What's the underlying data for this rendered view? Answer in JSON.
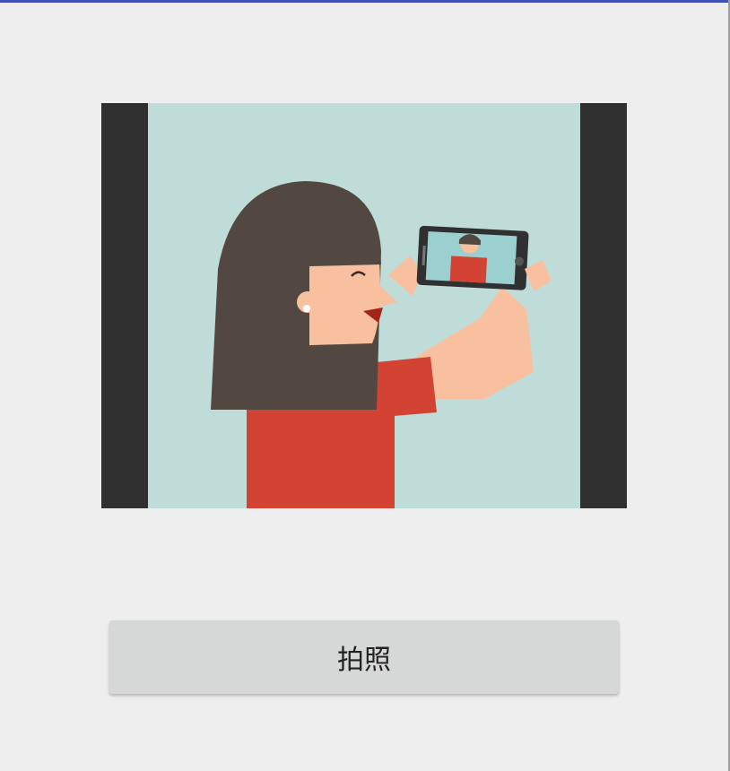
{
  "capture": {
    "button_label": "拍照"
  },
  "photo": {
    "icon": "selfie-illustration",
    "colors": {
      "frame": "#303030",
      "background": "#bfdcd8",
      "hair": "#524841",
      "skin": "#f9c0a0",
      "shirt": "#d24334",
      "phone": "#303030",
      "accent_top_bar": "#3f51b5"
    }
  }
}
